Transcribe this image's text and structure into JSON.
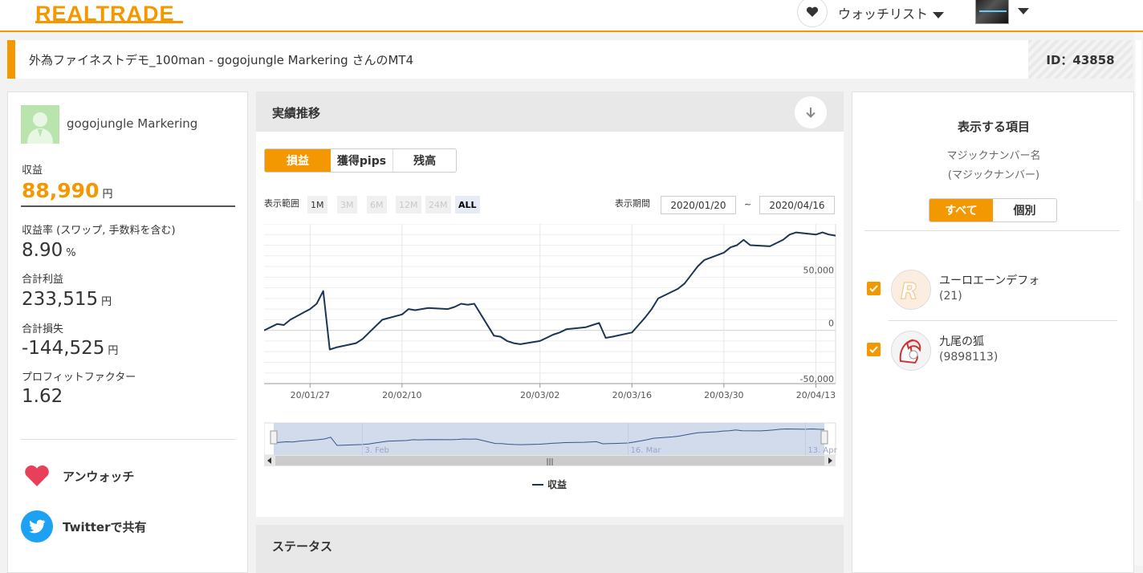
{
  "header": {
    "logo": "REALTRADE",
    "watchlist_label": "ウォッチリスト"
  },
  "titlebar": {
    "title": "外為ファイネストデモ_100man - gogojungle Markering さんのMT4",
    "id_label": "ID：43858"
  },
  "profile": {
    "name": "gogojungle Markering",
    "profit_label": "収益",
    "profit_value": "88,990",
    "yen": "円",
    "rate_label": "収益率 (スワップ, 手数料を含む)",
    "rate_value": "8.90",
    "rate_unit": "%",
    "total_profit_label": "合計利益",
    "total_profit_value": "233,515",
    "total_loss_label": "合計損失",
    "total_loss_value": "-144,525",
    "pf_label": "プロフィットファクター",
    "pf_value": "1.62",
    "unwatch_label": "アンウォッチ",
    "twitter_label": "Twitterで共有"
  },
  "performance": {
    "title": "実績推移",
    "tabs": [
      "損益",
      "獲得pips",
      "残高"
    ],
    "active_tab": 0,
    "range_label": "表示範囲",
    "range_buttons": [
      "1M",
      "3M",
      "6M",
      "12M",
      "24M",
      "ALL"
    ],
    "period_label": "表示期間",
    "date_from": "2020/01/20",
    "tilde": "~",
    "date_to": "2020/04/16",
    "legend": "収益",
    "status_title": "ステータス"
  },
  "chart_data": {
    "type": "line",
    "series": [
      {
        "name": "収益",
        "color": "#1c3553",
        "x": [
          "2020-01-20",
          "2020-01-21",
          "2020-01-22",
          "2020-01-23",
          "2020-01-24",
          "2020-01-27",
          "2020-01-28",
          "2020-01-29",
          "2020-01-30",
          "2020-01-31",
          "2020-02-03",
          "2020-02-04",
          "2020-02-05",
          "2020-02-06",
          "2020-02-07",
          "2020-02-10",
          "2020-02-11",
          "2020-02-12",
          "2020-02-13",
          "2020-02-14",
          "2020-02-17",
          "2020-02-18",
          "2020-02-19",
          "2020-02-20",
          "2020-02-21",
          "2020-02-24",
          "2020-02-25",
          "2020-02-26",
          "2020-02-27",
          "2020-02-28",
          "2020-03-02",
          "2020-03-03",
          "2020-03-04",
          "2020-03-05",
          "2020-03-06",
          "2020-03-09",
          "2020-03-10",
          "2020-03-11",
          "2020-03-12",
          "2020-03-13",
          "2020-03-16",
          "2020-03-17",
          "2020-03-18",
          "2020-03-19",
          "2020-03-20",
          "2020-03-23",
          "2020-03-24",
          "2020-03-25",
          "2020-03-26",
          "2020-03-27",
          "2020-03-30",
          "2020-03-31",
          "2020-04-01",
          "2020-04-02",
          "2020-04-03",
          "2020-04-06",
          "2020-04-07",
          "2020-04-08",
          "2020-04-09",
          "2020-04-10",
          "2020-04-13",
          "2020-04-14",
          "2020-04-15",
          "2020-04-16"
        ],
        "values": [
          0,
          3000,
          6000,
          5000,
          10000,
          20000,
          25000,
          37000,
          -18000,
          -16000,
          -12000,
          -8000,
          -2000,
          4000,
          10000,
          15000,
          20000,
          19000,
          20000,
          21000,
          20000,
          22000,
          25000,
          24000,
          25000,
          -5000,
          -6000,
          -10000,
          -12000,
          -13000,
          -10000,
          -7000,
          -4000,
          -2000,
          1000,
          3000,
          5000,
          7000,
          -7000,
          -6000,
          -2000,
          5000,
          12000,
          20000,
          30000,
          39000,
          44000,
          52000,
          60000,
          66000,
          73000,
          78000,
          80000,
          85000,
          80000,
          79000,
          82000,
          85000,
          90000,
          92000,
          90000,
          92000,
          90000,
          88990
        ]
      }
    ],
    "x_ticks": [
      "20/01/27",
      "20/02/10",
      "20/03/02",
      "20/03/16",
      "20/03/30",
      "20/04/13"
    ],
    "y_ticks": [
      "50,000",
      "0",
      "-50,000"
    ],
    "ylim": [
      -50000,
      100000
    ],
    "navigator_labels": [
      "3. Feb",
      "16. Mar",
      "13. Apr"
    ],
    "grid": true,
    "legend_position": "bottom-center"
  },
  "right": {
    "title": "表示する項目",
    "sub1": "マジックナンバー名",
    "sub2": "(マジックナンバー)",
    "toggle": [
      "すべて",
      "個別"
    ],
    "items": [
      {
        "name": "ユーロエーンデフォ",
        "magic": "(21)",
        "checked": true
      },
      {
        "name": "九尾の狐",
        "magic": "(9898113)",
        "checked": true
      }
    ]
  },
  "colors": {
    "accent": "#f39800",
    "line": "#1c3553",
    "navigator": "#cdd7ea"
  }
}
